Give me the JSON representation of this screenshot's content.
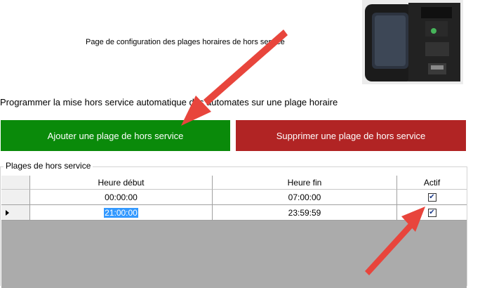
{
  "header": {
    "page_title": "Page de configuration des plages horaires de hors service"
  },
  "device_image": {
    "icon": "payment-terminal-image"
  },
  "intro_text": "Programmer la mise hors service automatique des automates sur une plage horaire",
  "buttons": {
    "add_label": "Ajouter une plage de hors service",
    "delete_label": "Supprimer une plage de hors service",
    "add_color": "#0a8a0a",
    "delete_color": "#b12424"
  },
  "group": {
    "title": "Plages de hors service",
    "columns": [
      "Heure début",
      "Heure fin",
      "Actif"
    ],
    "rows": [
      {
        "start": "00:00:00",
        "end": "07:00:00",
        "active": true
      },
      {
        "start": "21:00:00",
        "end": "23:59:59",
        "active": true
      }
    ]
  },
  "annotations": {
    "arrow_color": "#e8453c"
  }
}
